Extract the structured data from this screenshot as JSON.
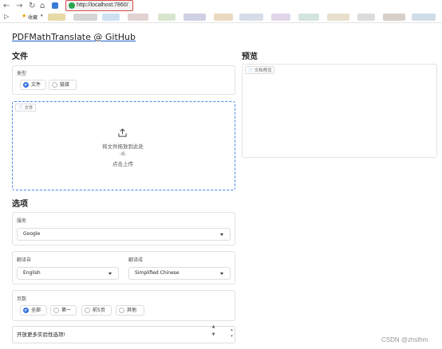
{
  "browser": {
    "url": "http://localhost:7860/",
    "bookmarks_label": "收藏"
  },
  "app": {
    "title": "PDFMathTranslate @ GitHub"
  },
  "file_section": {
    "heading": "文件",
    "type_label": "类型",
    "type_options": [
      "文件",
      "链接"
    ],
    "type_selected": "文件",
    "dropzone_tag": "文件",
    "drop_text": "将文件拖放到此处",
    "or_text": "-或-",
    "click_text": "点击上传"
  },
  "preview_section": {
    "heading": "预览",
    "tag": "文档预览"
  },
  "options_section": {
    "heading": "选项",
    "service_label": "服务",
    "service_value": "Google",
    "translate_from_label": "翻译自",
    "translate_from_value": "English",
    "translate_to_label": "翻译成",
    "translate_to_value": "Simplified Chinese",
    "pages_label": "页数",
    "pages_options": [
      "全部",
      "第一",
      "前5页",
      "其他"
    ],
    "pages_selected": "全部",
    "experimental_text": "开放更多实验性选项!"
  },
  "watermark": "CSDN @zhslhm",
  "colors": {
    "accent": "#2f6fe0",
    "highlight_border": "#d94a4a",
    "dropzone_border": "#4a84e6"
  }
}
